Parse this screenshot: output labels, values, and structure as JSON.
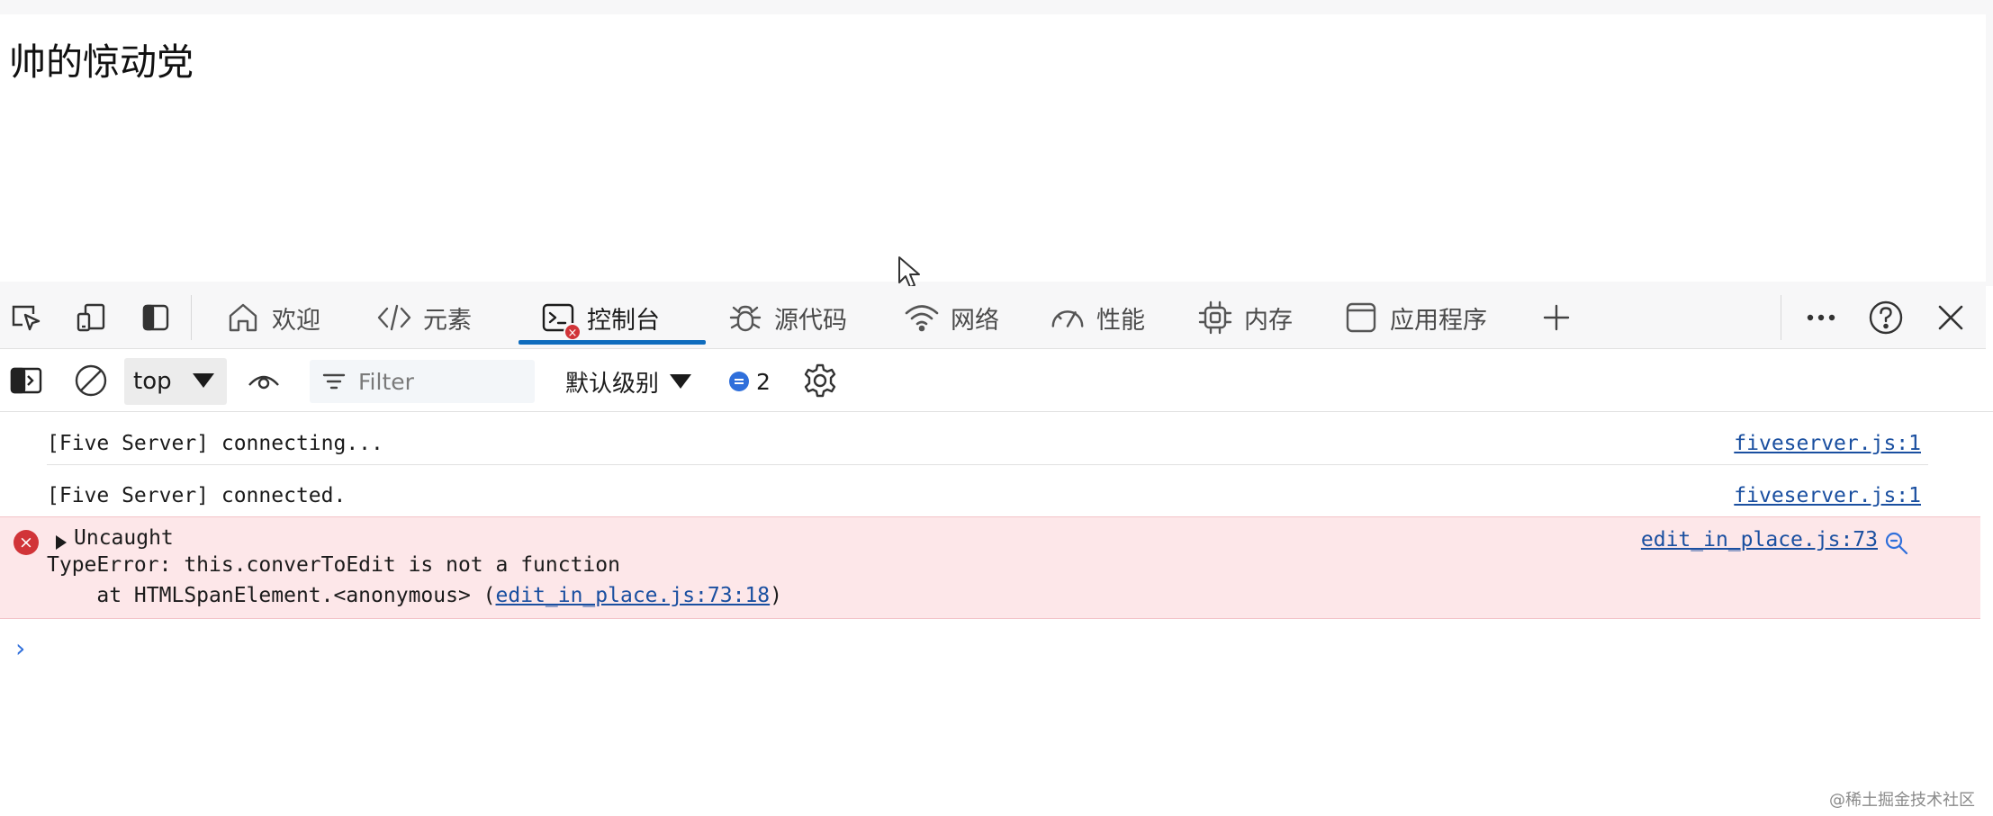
{
  "page": {
    "heading": "帅的惊动党"
  },
  "devtools": {
    "tabs": [
      {
        "label": "欢迎",
        "icon": "home-icon"
      },
      {
        "label": "元素",
        "icon": "code-icon"
      },
      {
        "label": "控制台",
        "icon": "console-icon",
        "active": true,
        "error_badge": "×"
      },
      {
        "label": "源代码",
        "icon": "bug-icon"
      },
      {
        "label": "网络",
        "icon": "wifi-icon"
      },
      {
        "label": "性能",
        "icon": "gauge-icon"
      },
      {
        "label": "内存",
        "icon": "chip-icon"
      },
      {
        "label": "应用程序",
        "icon": "window-icon"
      }
    ],
    "right_icons": [
      "more-icon",
      "help-icon",
      "close-icon"
    ],
    "toolbar": {
      "context": "top",
      "filter_placeholder": "Filter",
      "level": "默认级别",
      "issues_count": "2"
    },
    "messages": [
      {
        "text": "[Five Server] connecting...",
        "source": "fiveserver.js:1"
      },
      {
        "text": "[Five Server] connected.",
        "source": "fiveserver.js:1"
      }
    ],
    "error": {
      "icon": "×",
      "title": "Uncaught",
      "line1": "TypeError: this.converToEdit is not a function",
      "line2_prefix": "    at HTMLSpanElement.<anonymous> (",
      "line2_link": "edit_in_place.js:73:18",
      "line2_suffix": ")",
      "source": "edit_in_place.js:73"
    },
    "prompt": "›"
  },
  "watermark": "@稀土掘金技术社区",
  "colors": {
    "accent": "#0f6cbd",
    "error": "#d13438",
    "error_bg": "#fde7e9",
    "link": "#1a4fa0"
  }
}
